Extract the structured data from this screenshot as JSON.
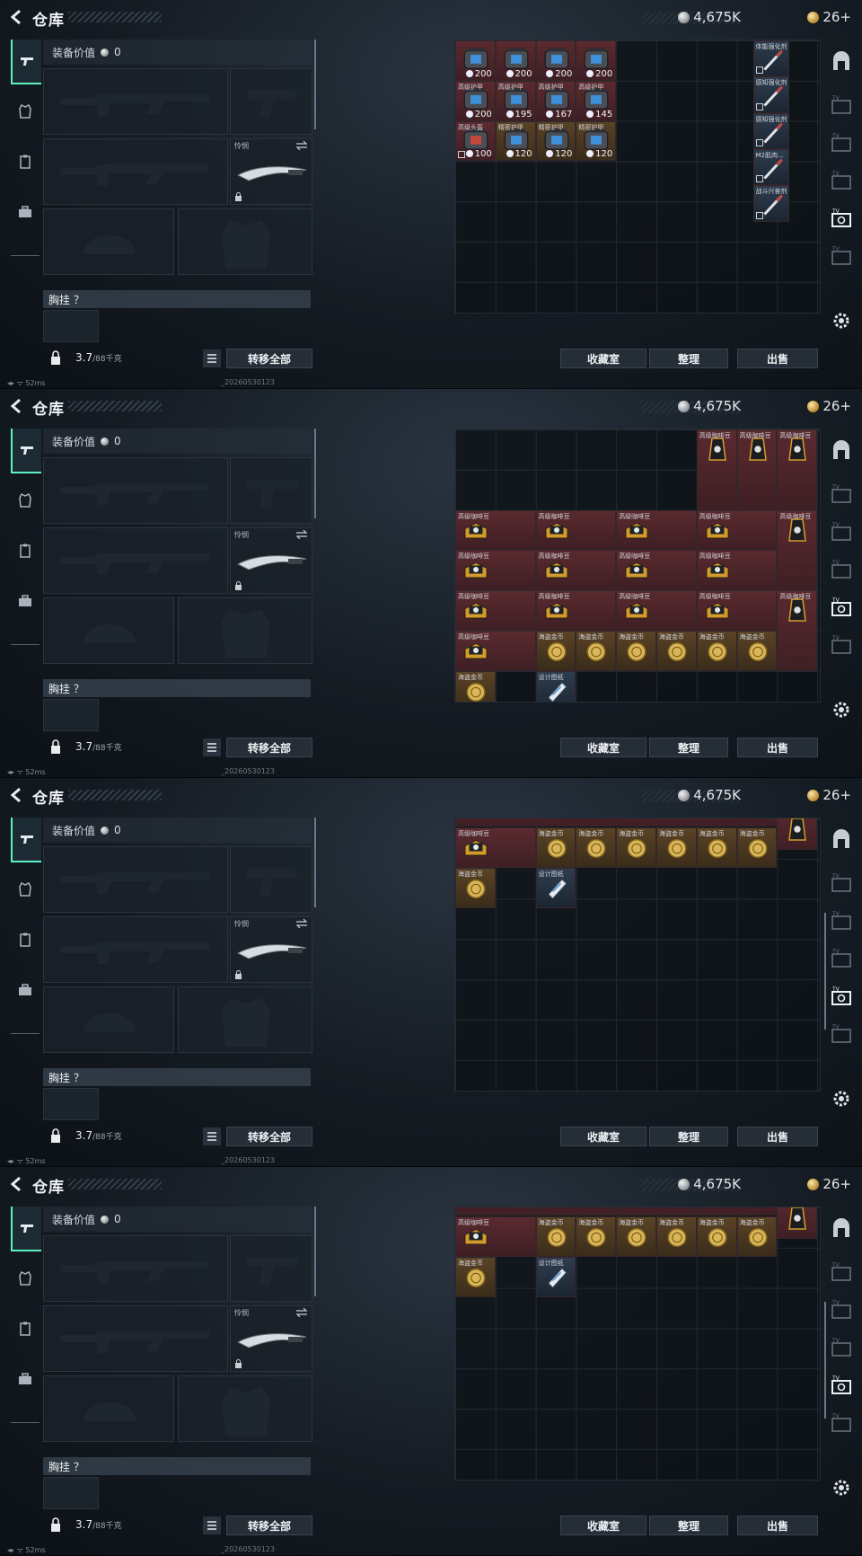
{
  "header": {
    "title": "仓库",
    "silver": "4,675K",
    "gold": "26+"
  },
  "equipment": {
    "value_label": "装备价值",
    "value": "0",
    "knife_label": "怜悯",
    "chest_label": "胸挂 ？",
    "weight": "3.7",
    "weight_cap": "/88千克",
    "transfer_all": "转移全部"
  },
  "storage_buttons": {
    "vault": "收藏室",
    "sort": "整理",
    "sell": "出售"
  },
  "status": {
    "ping": "52ms",
    "id": "_20260530123"
  },
  "frames": [
    {
      "items": [
        {
          "name": "",
          "value": "200",
          "kind": "armor",
          "color": "red",
          "col": 0,
          "row": 0
        },
        {
          "name": "",
          "value": "200",
          "kind": "armor",
          "color": "red",
          "col": 1,
          "row": 0
        },
        {
          "name": "",
          "value": "200",
          "kind": "armor",
          "color": "red",
          "col": 2,
          "row": 0
        },
        {
          "name": "",
          "value": "200",
          "kind": "armor",
          "color": "red",
          "col": 3,
          "row": 0
        },
        {
          "name": "高级护甲",
          "value": "200",
          "kind": "armor",
          "color": "red",
          "col": 0,
          "row": 1
        },
        {
          "name": "高级护甲",
          "value": "195",
          "kind": "armor",
          "color": "red",
          "col": 1,
          "row": 1
        },
        {
          "name": "高级护甲",
          "value": "167",
          "kind": "armor",
          "color": "red",
          "col": 2,
          "row": 1
        },
        {
          "name": "高级护甲",
          "value": "145",
          "kind": "armor",
          "color": "red",
          "col": 3,
          "row": 1
        },
        {
          "name": "高级头盔",
          "value": "100",
          "kind": "helmet",
          "color": "red",
          "col": 0,
          "row": 2
        },
        {
          "name": "精密护甲",
          "value": "120",
          "kind": "armor",
          "color": "gold",
          "col": 1,
          "row": 2
        },
        {
          "name": "精密护甲",
          "value": "120",
          "kind": "armor",
          "color": "gold",
          "col": 2,
          "row": 2
        },
        {
          "name": "精密护甲",
          "value": "120",
          "kind": "armor",
          "color": "gold",
          "col": 3,
          "row": 2
        }
      ],
      "syringes": [
        {
          "name": "体能强化剂",
          "slot": 0
        },
        {
          "name": "感知强化剂",
          "slot": 1
        },
        {
          "name": "感知强化剂",
          "slot": 2
        },
        {
          "name": "M2肌肉...",
          "slot": 3
        },
        {
          "name": "战斗兴奋剂",
          "slot": 4
        }
      ]
    },
    {
      "coffee_bags": [
        "高级咖啡豆",
        "高级咖啡豆",
        "高级咖啡豆",
        "高级咖啡豆",
        "高级咖啡豆"
      ],
      "coffee_boxes": [
        "高级咖啡豆",
        "高级咖啡豆",
        "高级咖啡豆",
        "高级咖啡豆",
        "高级咖啡豆",
        "高级咖啡豆",
        "高级咖啡豆",
        "高级咖啡豆",
        "高级咖啡豆",
        "高级咖啡豆",
        "高级咖啡豆",
        "高级咖啡豆",
        "高级咖啡豆"
      ],
      "coins": [
        "海盗金币",
        "海盗金币",
        "海盗金币",
        "海盗金币",
        "海盗金币",
        "海盗金币",
        "海盗金币"
      ],
      "blueprint": "设计图纸"
    },
    {
      "coffee_boxes": [
        "高级咖啡豆"
      ],
      "coins": [
        "海盗金币",
        "海盗金币",
        "海盗金币",
        "海盗金币",
        "海盗金币",
        "海盗金币",
        "海盗金币"
      ],
      "blueprint": "设计图纸"
    },
    {
      "coffee_boxes": [
        "高级咖啡豆"
      ],
      "coins": [
        "海盗金币",
        "海盗金币",
        "海盗金币",
        "海盗金币",
        "海盗金币",
        "海盗金币",
        "海盗金币"
      ],
      "blueprint": "设计图纸"
    }
  ],
  "colors": {
    "accent": "#5ef0c0",
    "item_red": "#5a2a2f",
    "item_gold": "#5a4326"
  }
}
